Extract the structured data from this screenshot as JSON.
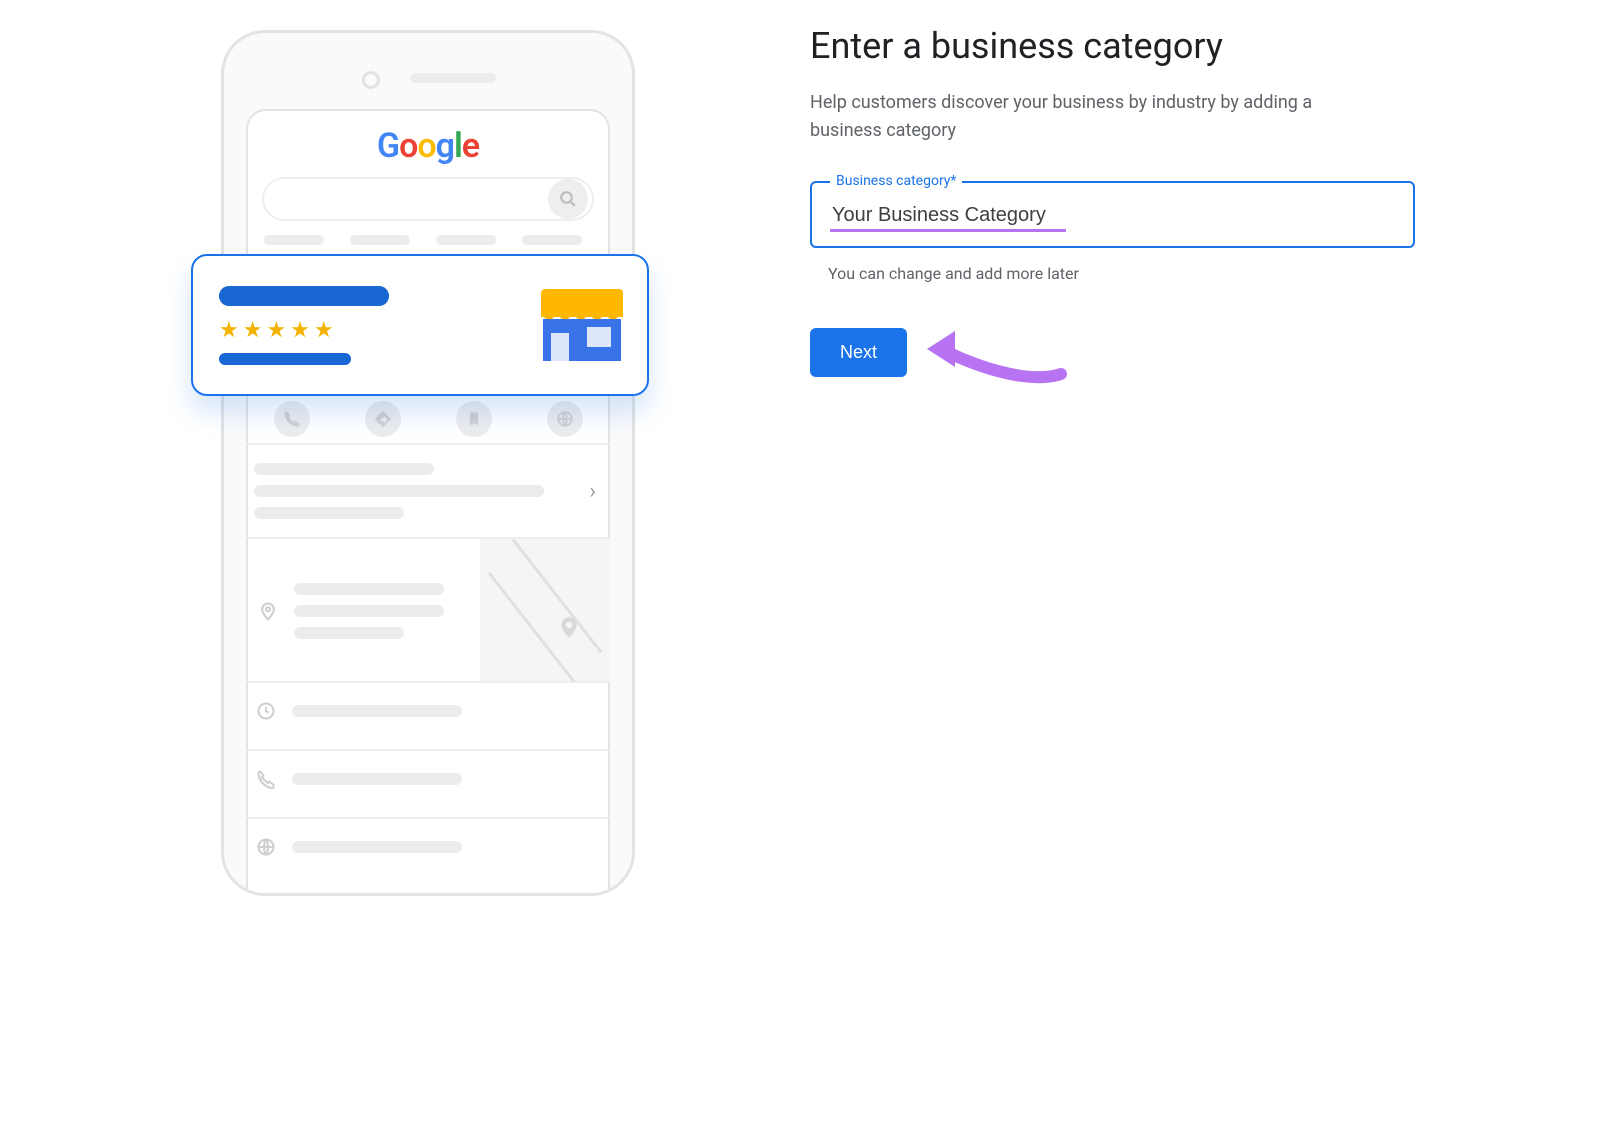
{
  "heading": "Enter a business category",
  "subheading": "Help customers discover your business by industry by adding a business category",
  "field": {
    "label": "Business category*",
    "value": "Your Business Category"
  },
  "helper_text": "You can change and add more later",
  "next_button_label": "Next",
  "illustration": {
    "logo_text": "Google",
    "rating_stars": 5
  },
  "colors": {
    "accent": "#1a73e8",
    "annotation": "#b773f2",
    "star": "#f2b400"
  }
}
